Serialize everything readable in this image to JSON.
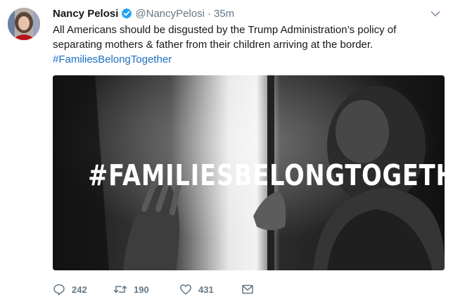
{
  "tweet": {
    "author_name": "Nancy Pelosi",
    "handle": "@NancyPelosi",
    "separator": "·",
    "time": "35m",
    "text_line1": "All Americans should be disgusted by the Trump Administration’s policy of",
    "text_line2": "separating mothers & father from their children arriving at the border.",
    "hashtag": "#FamiliesBelongTogether",
    "image_overlay_text": "#FAMILIESBELONGTOGETHER"
  },
  "actions": {
    "reply_count": "242",
    "retweet_count": "190",
    "like_count": "431"
  },
  "icons": {
    "verified": "verified-badge-icon",
    "caret": "chevron-down-icon",
    "reply": "reply-icon",
    "retweet": "retweet-icon",
    "like": "heart-icon",
    "dm": "envelope-icon"
  },
  "colors": {
    "verified_blue": "#1da1f2",
    "hashtag": "#1b6ec2",
    "secondary_text": "#657786"
  }
}
